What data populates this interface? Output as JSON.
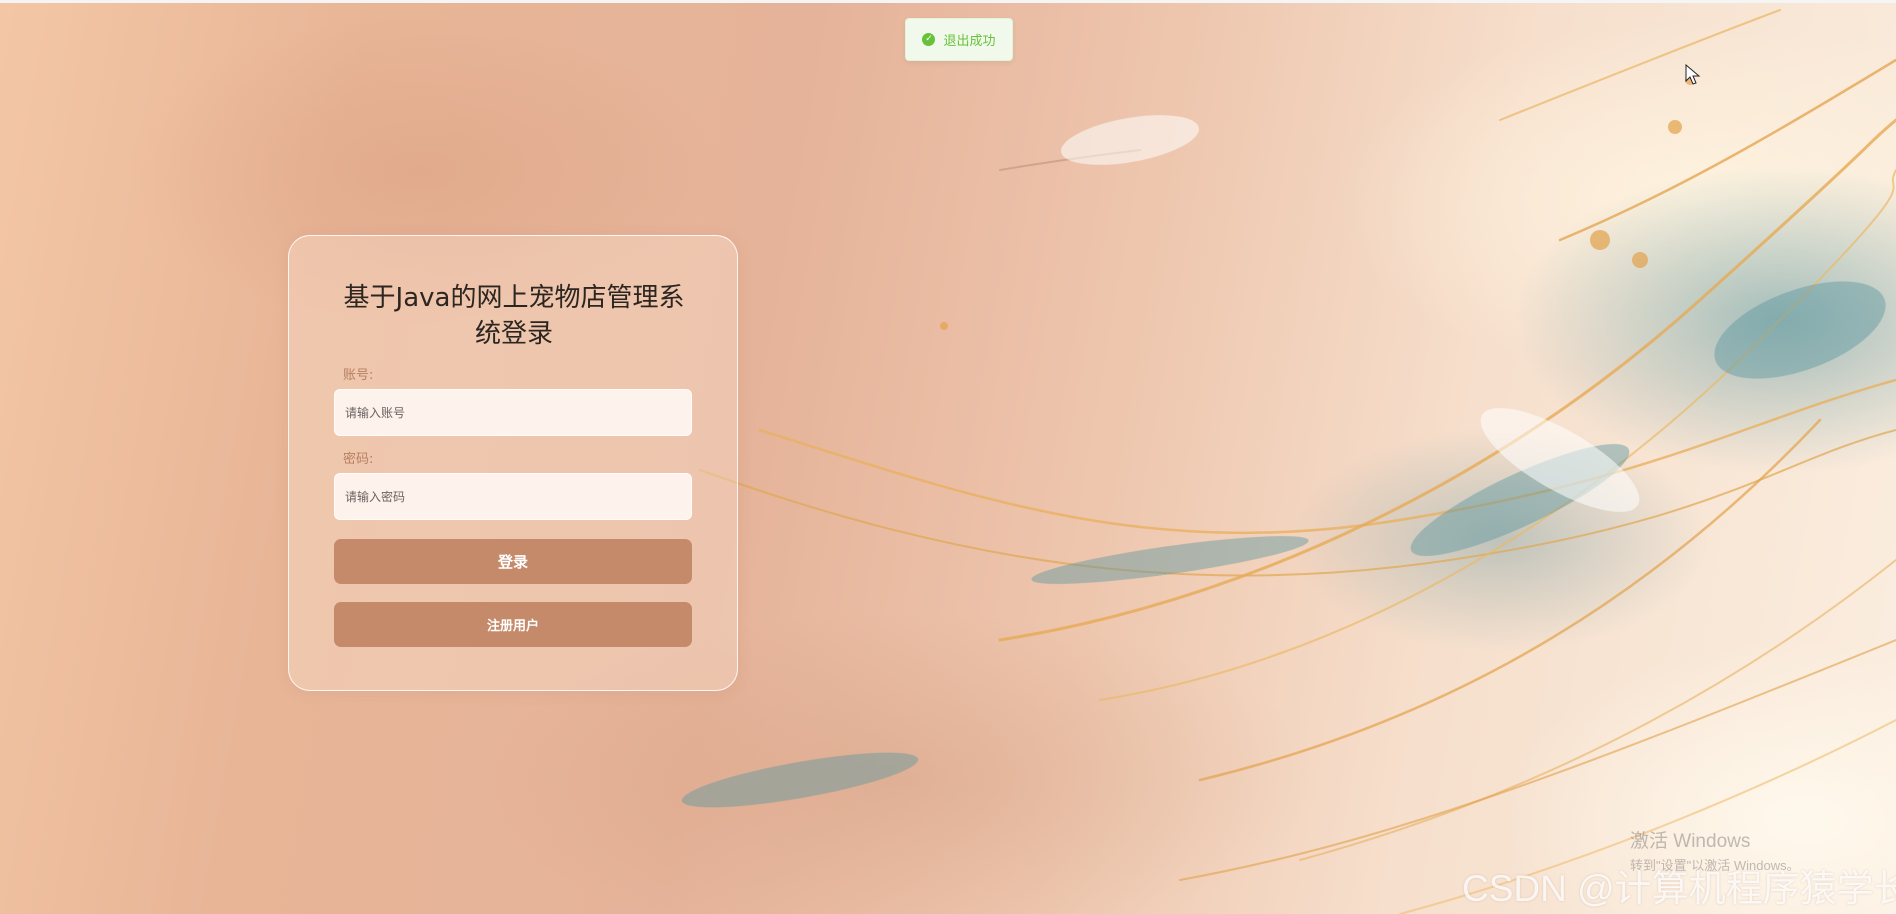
{
  "toast": {
    "icon": "check-circle-icon",
    "text": "退出成功",
    "color": "#67c23a"
  },
  "login": {
    "title": "基于Java的网上宠物店管理系统登录",
    "account_label": "账号:",
    "account_placeholder": "请输入账号",
    "account_value": "",
    "password_label": "密码:",
    "password_placeholder": "请输入密码",
    "password_value": "",
    "login_button": "登录",
    "register_button": "注册用户",
    "button_color": "#c58a69",
    "label_color": "#b67f63"
  },
  "os_overlay": {
    "activate_title": "激活 Windows",
    "activate_hint": "转到\"设置\"以激活 Windows。"
  },
  "watermark": "CSDN @计算机程序猿学长"
}
